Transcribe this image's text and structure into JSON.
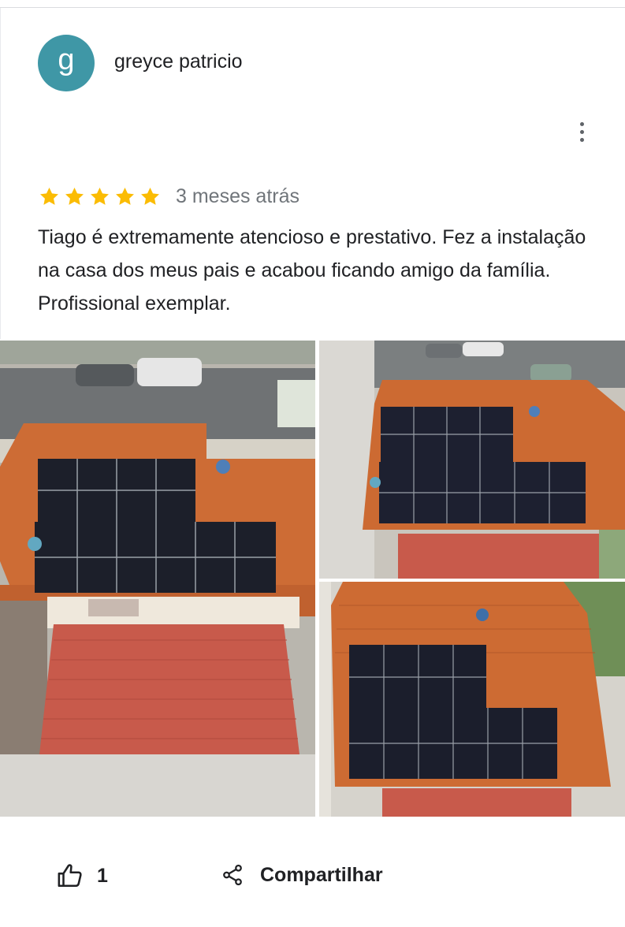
{
  "review": {
    "author": "greyce patricio",
    "avatar_letter": "g",
    "avatar_color": "#3f97a6",
    "rating": 5,
    "star_color": "#fbbc04",
    "time": "3 meses atrás",
    "text": "Tiago é extremamente atencioso e prestativo. Fez a instalação na casa dos meus pais e acabou ficando amigo da família. Profissional exemplar."
  },
  "photos": [
    {
      "name": "photo-rooftop-solar-1",
      "description": "aerial photo of solar panels on orange tiled roof"
    },
    {
      "name": "photo-rooftop-solar-2",
      "description": "aerial photo of solar panels on orange tiled roof"
    },
    {
      "name": "photo-rooftop-solar-3",
      "description": "aerial photo of solar panels on orange tiled roof"
    }
  ],
  "actions": {
    "like_icon": "thumbs-up-icon",
    "like_count": "1",
    "share_icon": "share-icon",
    "share_label": "Compartilhar"
  },
  "menu_icon": "more-vert-icon"
}
